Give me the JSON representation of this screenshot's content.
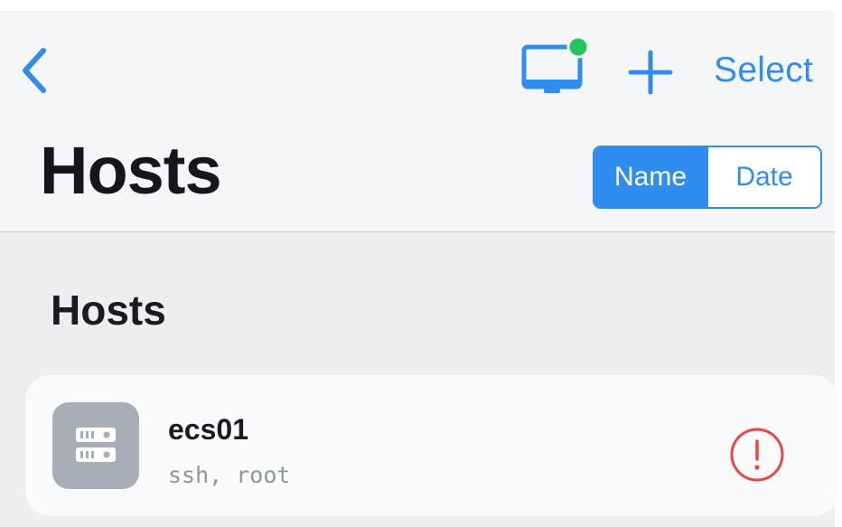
{
  "nav": {
    "back_icon": "chevron-left-icon",
    "monitor_icon": "monitor-icon",
    "monitor_status_color": "#22c55e",
    "add_icon": "plus-icon",
    "select_label": "Select"
  },
  "page": {
    "title": "Hosts"
  },
  "sort": {
    "options": [
      "Name",
      "Date"
    ],
    "selected": "Name"
  },
  "section": {
    "title": "Hosts"
  },
  "hosts": [
    {
      "name": "ecs01",
      "detail": "ssh, root",
      "icon": "server-icon",
      "status_icon": "warning-icon",
      "status_color": "#ef4444"
    }
  ],
  "colors": {
    "accent": "#2f8df0",
    "header_bg": "#f5f6f8",
    "list_bg": "#eceef0"
  }
}
